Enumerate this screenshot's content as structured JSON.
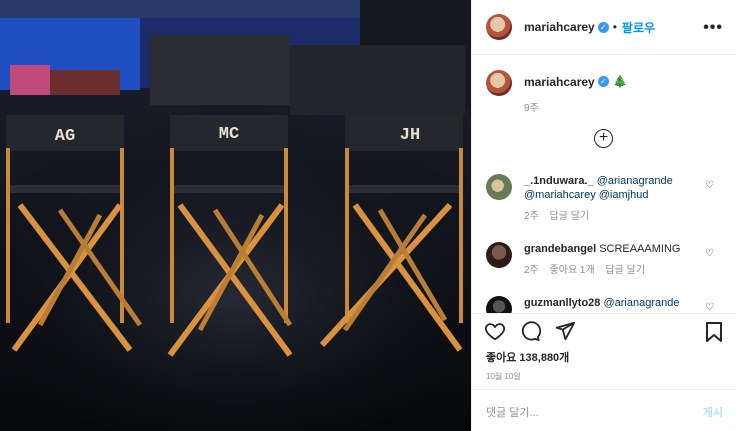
{
  "post": {
    "photo": {
      "chairs": [
        {
          "label": "AG"
        },
        {
          "label": "MC"
        },
        {
          "label": "JH"
        }
      ]
    },
    "header": {
      "username": "mariahcarey",
      "verified_mark": "✓",
      "follow_label": "팔로우",
      "more_label": "•••"
    },
    "caption": {
      "username": "mariahcarey",
      "emoji": "🎄",
      "time": "9주"
    },
    "load_more_label": "+",
    "comments": [
      {
        "username": "_.1nduwara._",
        "text_parts": [
          "@arianagrande",
          "@mariahcarey",
          "@iamjhud"
        ],
        "time": "2주",
        "likes": "",
        "reply_label": "답글 달기"
      },
      {
        "username": "grandebangel",
        "text": "SCREAAAMING",
        "time": "2주",
        "likes": "좋아요 1개",
        "reply_label": "답글 달기"
      },
      {
        "username": "guzmanllyto28",
        "text": "@arianagrande",
        "time": "",
        "likes": "",
        "reply_label": ""
      }
    ],
    "likes_text": "좋아요 138,880개",
    "date": "10월 10일",
    "comment_placeholder": "댓글 달기...",
    "post_button": "게시",
    "colors": {
      "link": "#00376b",
      "follow": "#0095f6",
      "muted": "#8e8e8e"
    }
  }
}
